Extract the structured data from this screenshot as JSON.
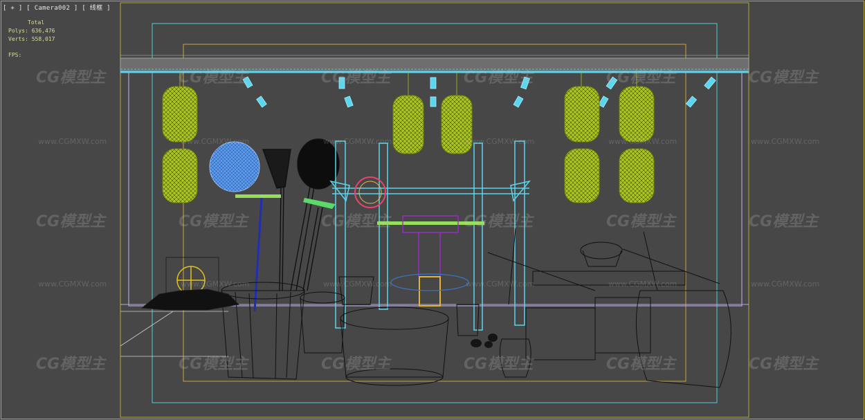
{
  "viewport": {
    "label": "[ + ] [ Camera002 ] [ 线框 ]",
    "stats": {
      "total_label": "Total",
      "polys_label": "Polys:",
      "polys_value": "636,476",
      "verts_label": "Verts:",
      "verts_value": "558,017",
      "fps_label": "FPS:"
    }
  },
  "watermark": {
    "logo": "CG模型主",
    "url": "www.CGMXW.com"
  },
  "colors": {
    "background": "#474747",
    "safe_frame_outer": "#b9a53a",
    "safe_frame_action": "#4fd0dc",
    "lantern": "#a8c21e",
    "wire_cyan": "#5ad6ee",
    "wire_black": "#111111",
    "sphere_blue": "#5a9bf0"
  }
}
